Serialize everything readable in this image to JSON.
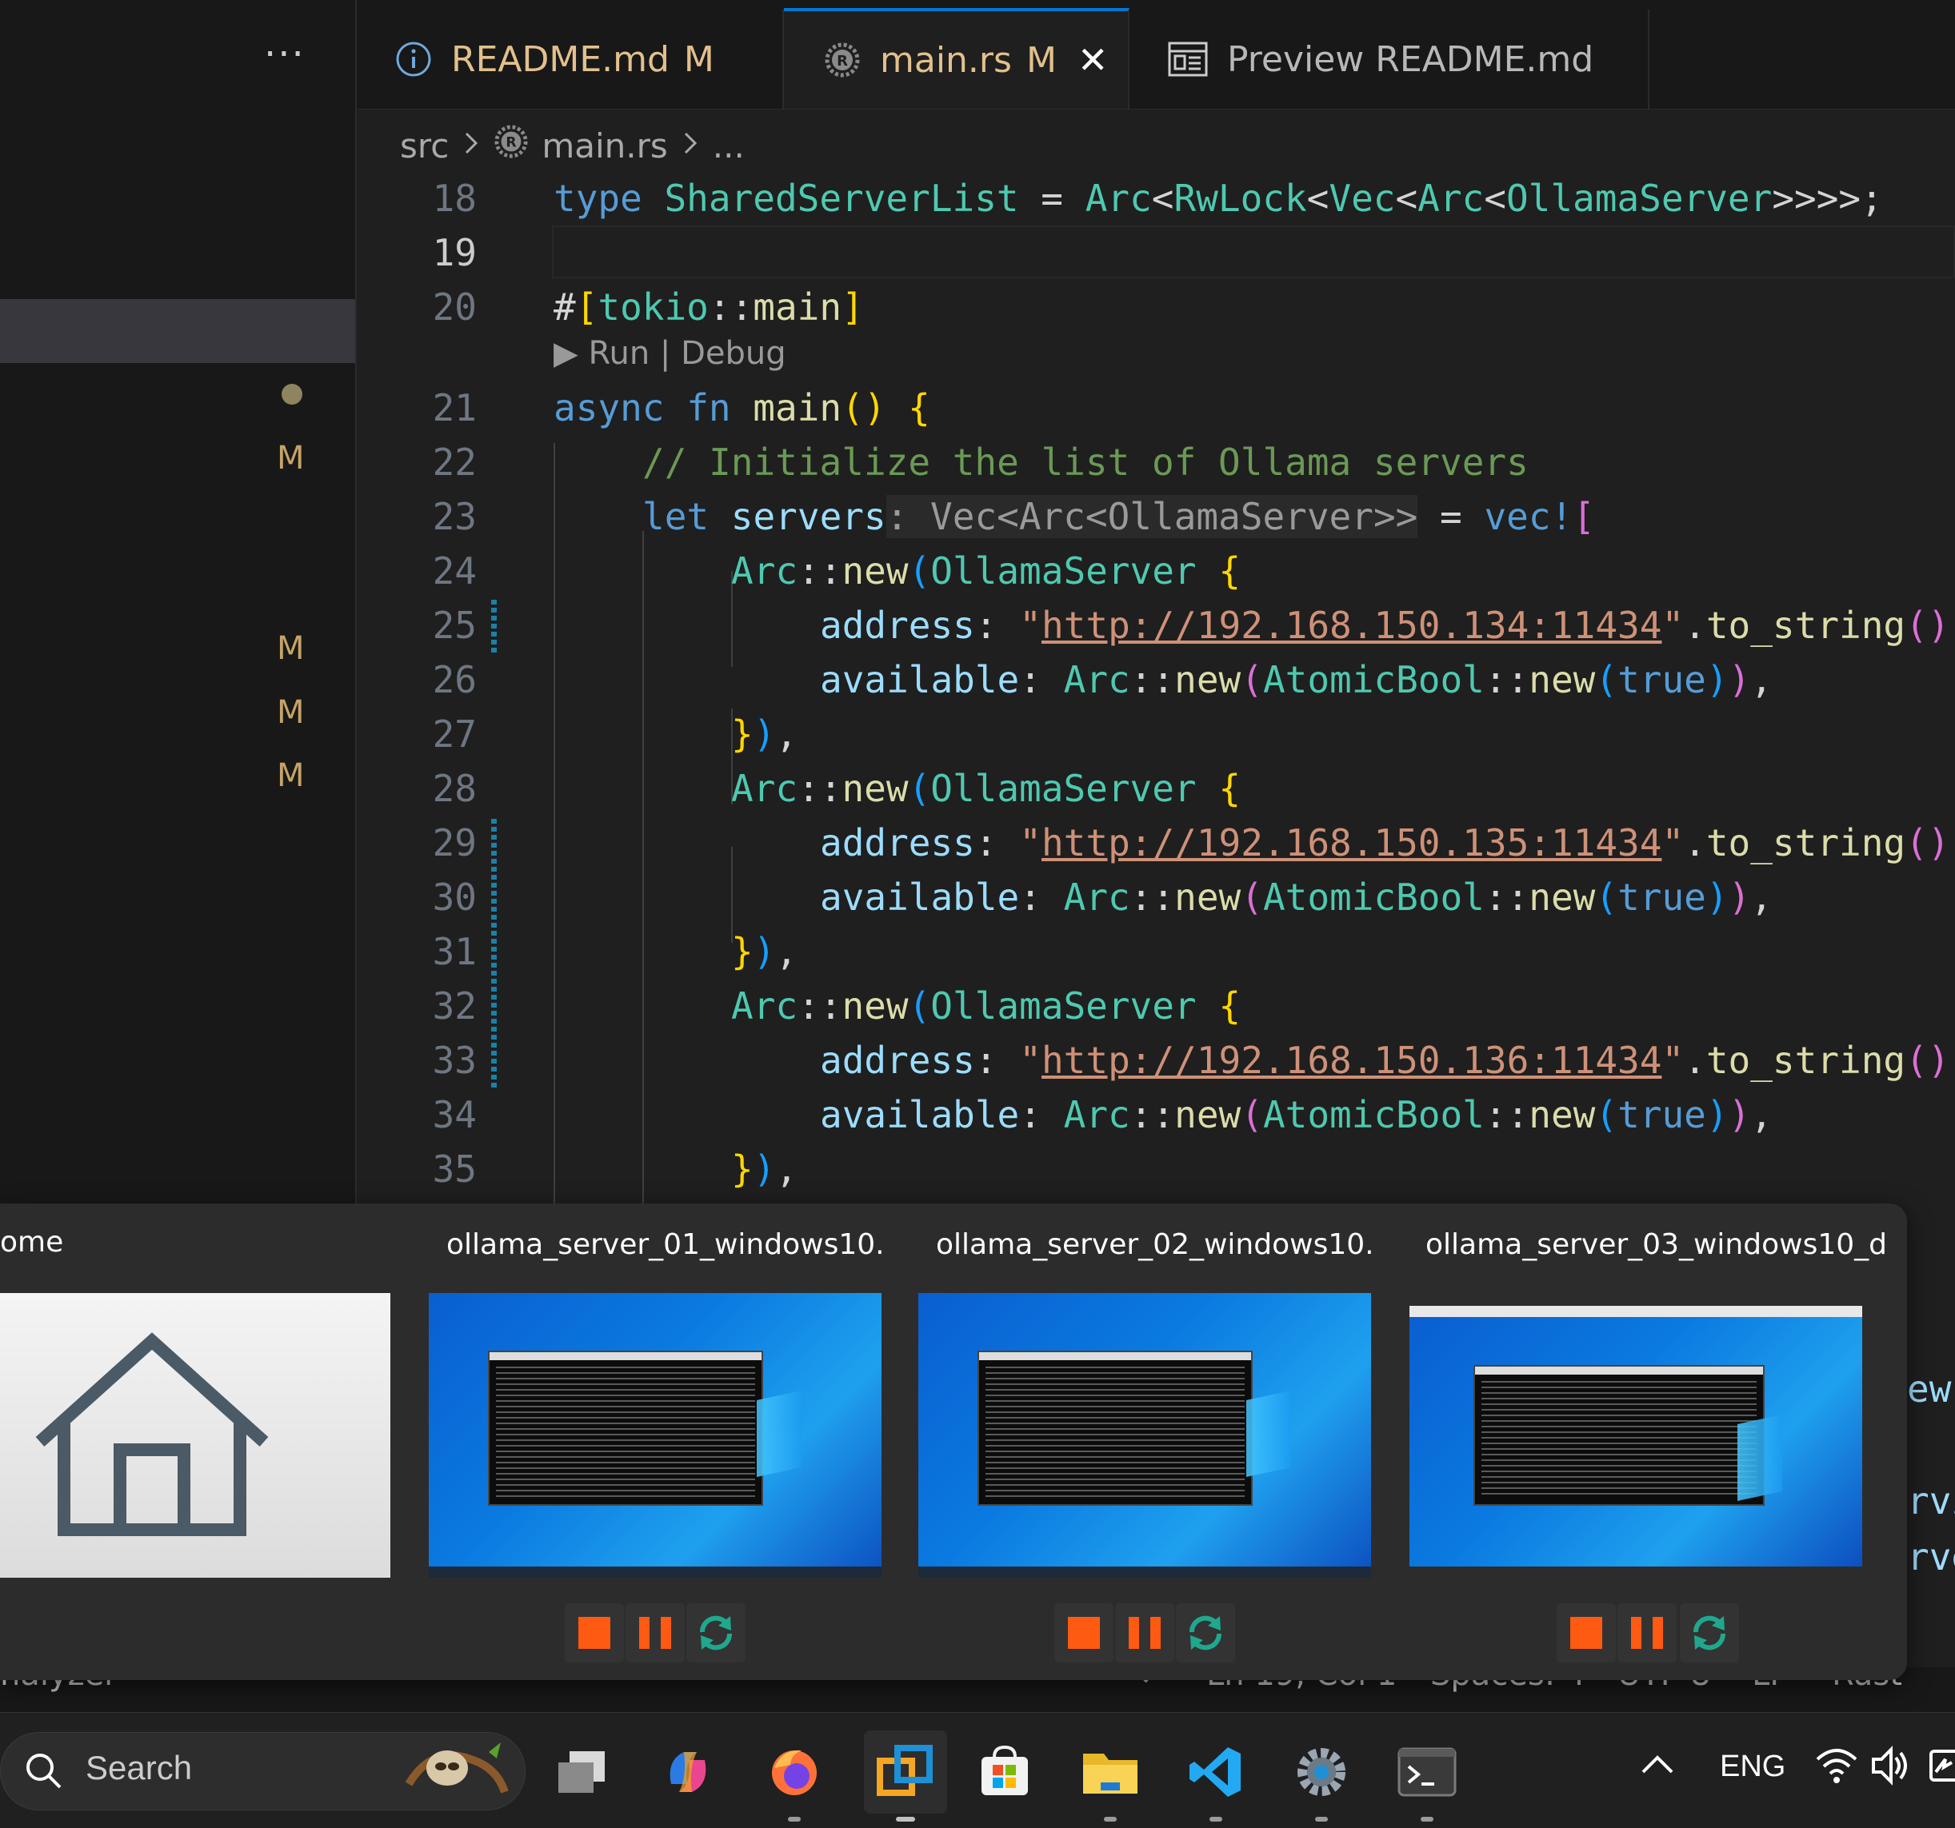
{
  "sidebar": {
    "more_label": "···",
    "git_markers": [
      "M",
      "M",
      "M",
      "M"
    ]
  },
  "tabs": [
    {
      "label": "README.md",
      "status": "M",
      "icon": "info-icon"
    },
    {
      "label": "main.rs",
      "status": "M",
      "icon": "rust-icon",
      "active": true
    },
    {
      "label": "Preview README.md",
      "icon": "preview-icon"
    }
  ],
  "breadcrumb": {
    "folder": "src",
    "file": "main.rs",
    "more": "..."
  },
  "editor": {
    "codelens": "▶ Run | Debug",
    "line_numbers": [
      "18",
      "19",
      "20",
      "21",
      "22",
      "23",
      "24",
      "25",
      "26",
      "27",
      "28",
      "29",
      "30",
      "31",
      "32",
      "33",
      "34",
      "35"
    ],
    "comment": "// Initialize the list of Ollama servers",
    "addresses": [
      "http://192.168.150.134:11434",
      "http://192.168.150.135:11434",
      "http://192.168.150.136:11434"
    ],
    "type_hint": ": Vec<Arc<OllamaServer>>"
  },
  "status_bar": {
    "left": "nalyzer",
    "position": "Ln 19, Col 1",
    "spaces": "Spaces: 4",
    "encoding": "UTF-8",
    "eol": "LF",
    "language": "Rust"
  },
  "task_preview": {
    "items": [
      {
        "title": "ome"
      },
      {
        "title": "ollama_server_01_windows10..."
      },
      {
        "title": "ollama_server_02_windows10..."
      },
      {
        "title": "ollama_server_03_windows10_d..."
      }
    ],
    "behind_text": [
      "ew",
      "rvi",
      "rve"
    ]
  },
  "taskbar": {
    "search_placeholder": "Search",
    "apps": [
      "task-view-icon",
      "copilot-icon",
      "firefox-icon",
      "vmware-icon",
      "store-icon",
      "file-explorer-icon",
      "vscode-icon",
      "settings-icon",
      "terminal-icon"
    ],
    "language": "ENG"
  },
  "colors": {
    "accent": "#0078d4",
    "modified": "#e2c08d",
    "stop": "#ff5a12",
    "refresh": "#1fa88e"
  }
}
